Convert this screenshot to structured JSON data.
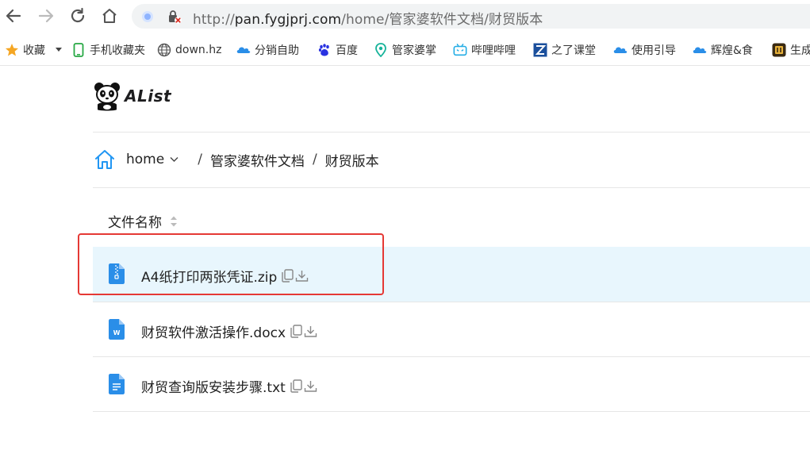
{
  "browser": {
    "url_protocol": "http://",
    "url_host": "pan.fygjprj.com",
    "url_path": "/home/管家婆软件文档/财贸版本"
  },
  "bookmarks": [
    {
      "label": "收藏",
      "icon": "star-icon"
    },
    {
      "label": "手机收藏夹",
      "icon": "phone-icon"
    },
    {
      "label": "down.hz",
      "icon": "globe-icon"
    },
    {
      "label": "分销自助",
      "icon": "cloud-icon"
    },
    {
      "label": "百度",
      "icon": "baidu-paw-icon"
    },
    {
      "label": "管家婆掌",
      "icon": "location-pin-icon"
    },
    {
      "label": "哔哩哔哩",
      "icon": "bilibili-tv-icon"
    },
    {
      "label": "之了课堂",
      "icon": "z-logo-icon"
    },
    {
      "label": "使用引导",
      "icon": "cloud-icon"
    },
    {
      "label": "辉煌&食",
      "icon": "cloud-icon"
    },
    {
      "label": "生成",
      "icon": "app-icon"
    }
  ],
  "logo": {
    "text": "AList"
  },
  "breadcrumb": {
    "home": "home",
    "sep": "/",
    "items": [
      "管家婆软件文档",
      "财贸版本"
    ]
  },
  "table": {
    "header": "文件名称",
    "files": [
      {
        "name": "A4纸打印两张凭证.zip",
        "type": "zip",
        "icon": "zip-file-icon"
      },
      {
        "name": "财贸软件激活操作.docx",
        "type": "docx",
        "icon": "word-file-icon"
      },
      {
        "name": "财贸查询版安装步骤.txt",
        "type": "txt",
        "icon": "text-file-icon"
      }
    ]
  },
  "colors": {
    "accent": "#2196f3",
    "highlight_row": "#e8f6fd",
    "annotation": "#e53935"
  }
}
